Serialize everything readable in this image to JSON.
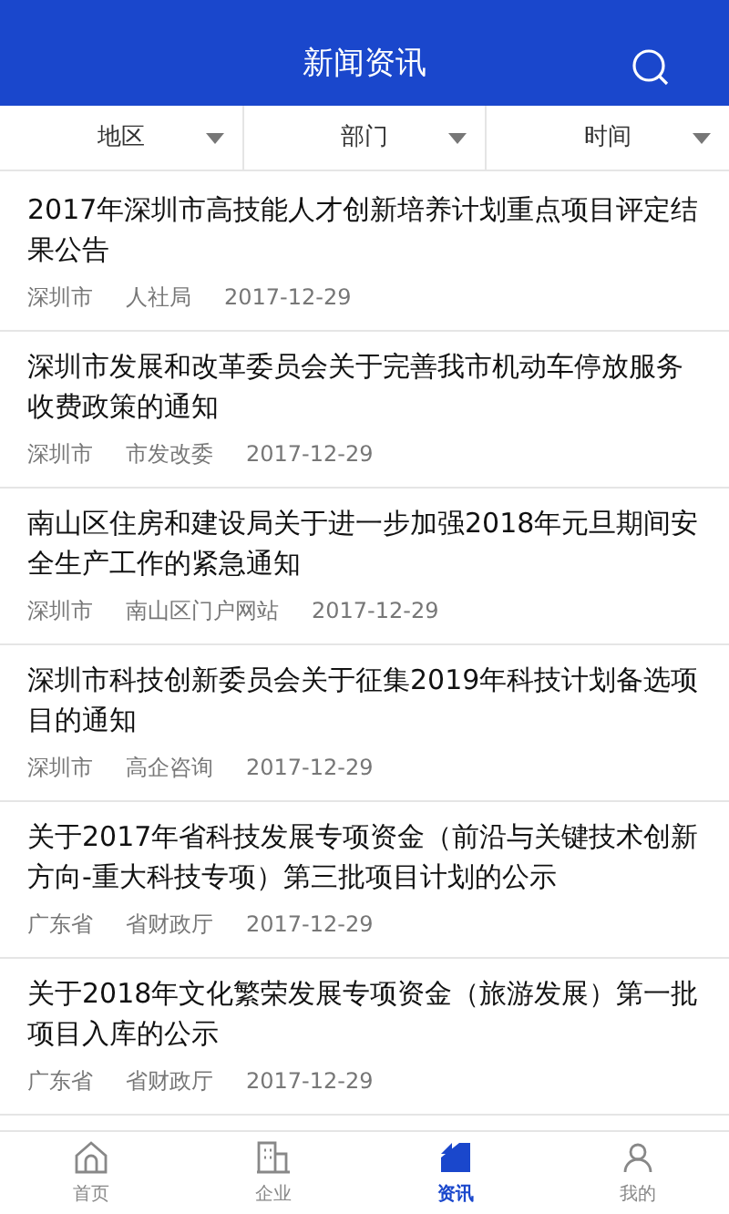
{
  "header": {
    "title": "新闻资讯"
  },
  "filters": [
    {
      "label": "地区"
    },
    {
      "label": "部门"
    },
    {
      "label": "时间"
    }
  ],
  "articles": [
    {
      "title": "2017年深圳市高技能人才创新培养计划重点项目评定结果公告",
      "region": "深圳市",
      "department": "人社局",
      "date": "2017-12-29"
    },
    {
      "title": "深圳市发展和改革委员会关于完善我市机动车停放服务收费政策的通知",
      "region": "深圳市",
      "department": "市发改委",
      "date": "2017-12-29"
    },
    {
      "title": "南山区住房和建设局关于进一步加强2018年元旦期间安全生产工作的紧急通知",
      "region": "深圳市",
      "department": "南山区门户网站",
      "date": "2017-12-29"
    },
    {
      "title": "深圳市科技创新委员会关于征集2019年科技计划备选项目的通知",
      "region": "深圳市",
      "department": "高企咨询",
      "date": "2017-12-29"
    },
    {
      "title": "关于2017年省科技发展专项资金（前沿与关键技术创新方向-重大科技专项）第三批项目计划的公示",
      "region": "广东省",
      "department": "省财政厅",
      "date": "2017-12-29"
    },
    {
      "title": "关于2018年文化繁荣发展专项资金（旅游发展）第一批项目入库的公示",
      "region": "广东省",
      "department": "省财政厅",
      "date": "2017-12-29"
    }
  ],
  "tab_bar": [
    {
      "kind": "home",
      "label": "首页",
      "selected": false
    },
    {
      "kind": "company",
      "label": "企业",
      "selected": false
    },
    {
      "kind": "news",
      "label": "资讯",
      "selected": true
    },
    {
      "kind": "me",
      "label": "我的",
      "selected": false
    }
  ]
}
